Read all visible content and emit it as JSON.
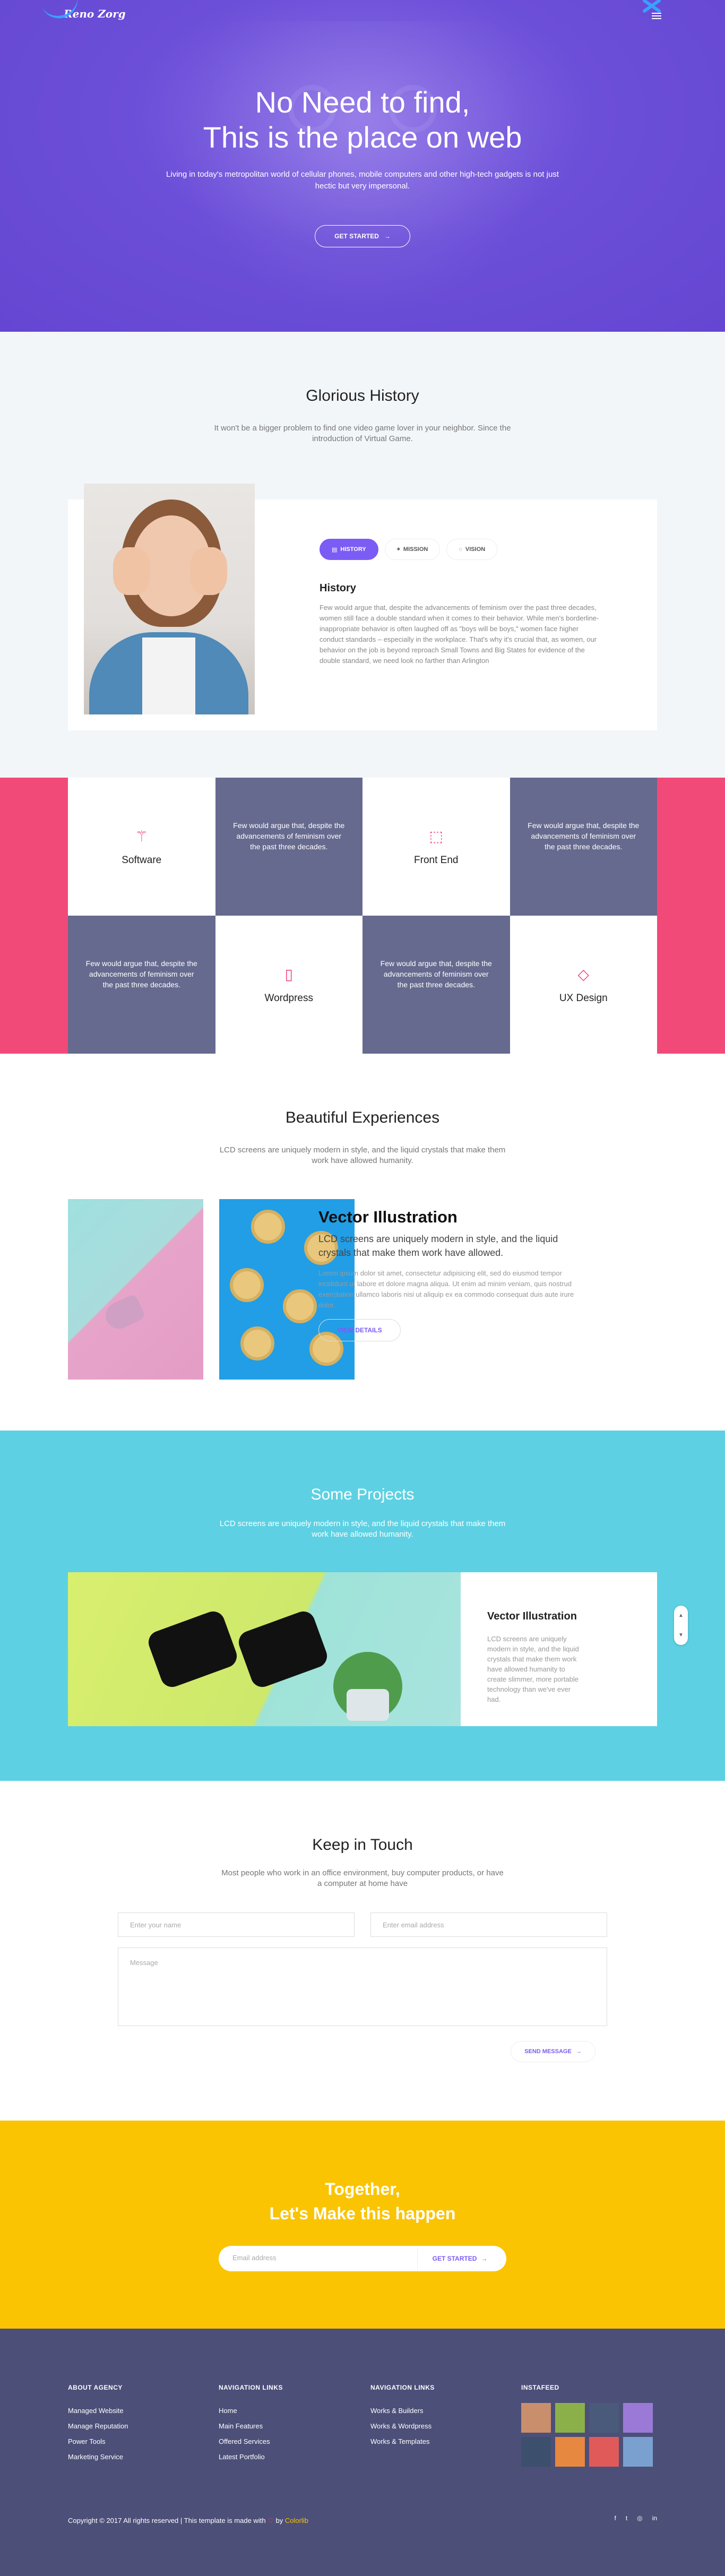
{
  "header": {
    "logo": "Reno Zorg",
    "hero_title_line1": "No Need to find,",
    "hero_title_line2": "This is the place on web",
    "hero_sub": "Living in today's metropolitan world of cellular phones, mobile computers and other high-tech gadgets is not just hectic but very impersonal.",
    "hero_button": "GET STARTED"
  },
  "history": {
    "title": "Glorious History",
    "text": "It won't be a bigger problem to find one video game lover in your neighbor. Since the introduction of Virtual Game.",
    "tabs": [
      {
        "label": "HISTORY",
        "active": true
      },
      {
        "label": "MISSION",
        "active": false
      },
      {
        "label": "VISION",
        "active": false
      }
    ],
    "heading": "History",
    "paragraph": "Few would argue that, despite the advancements of feminism over the past three decades, women still face a double standard when it comes to their behavior. While men's borderline-inappropriate behavior is often laughed off as \"boys will be boys,\" women face higher conduct standards – especially in the workplace. That's why it's crucial that, as women, our behavior on the job is beyond reproach Small Towns and Big States for evidence of the double standard, we need look no farther than Arlington"
  },
  "features": {
    "cells": [
      {
        "type": "icon",
        "label": "Software",
        "icon": "magic-wand-icon"
      },
      {
        "type": "text",
        "text": "Few would argue that, despite the advancements of feminism over the past three decades."
      },
      {
        "type": "icon",
        "label": "Front End",
        "icon": "cursor-icon"
      },
      {
        "type": "text",
        "text": "Few would argue that, despite the advancements of feminism over the past three decades."
      },
      {
        "type": "text",
        "text": "Few would argue that, despite the advancements of feminism over the past three decades."
      },
      {
        "type": "icon",
        "label": "Wordpress",
        "icon": "tablet-icon"
      },
      {
        "type": "text",
        "text": "Few would argue that, despite the advancements of feminism over the past three decades."
      },
      {
        "type": "icon",
        "label": "UX Design",
        "icon": "diamond-icon"
      }
    ]
  },
  "experiences": {
    "title": "Beautiful Experiences",
    "text": "LCD screens are uniquely modern in style, and the liquid crystals that make them work have allowed humanity.",
    "heading": "Vector Illustration",
    "lead": "LCD screens are uniquely modern in style, and the liquid crystals that make them work have allowed.",
    "paragraph": "Lorem ipsum dolor sit amet, consectetur adipisicing elit, sed do eiusmod tempor incididunt ut labore et dolore magna aliqua. Ut enim ad minim veniam, quis nostrud exercitation ullamco laboris nisi ut aliquip ex ea commodo consequat duis aute irure dolor.",
    "button": "VIEW DETAILS"
  },
  "projects": {
    "title": "Some Projects",
    "text": "LCD screens are uniquely modern in style, and the liquid crystals that make them work have allowed humanity.",
    "heading": "Vector Illustration",
    "paragraph": "LCD screens are uniquely modern in style, and the liquid crystals that make them work have allowed humanity to create slimmer, more portable technology than we've ever had."
  },
  "contact": {
    "title": "Keep in Touch",
    "text": "Most people who work in an office environment, buy computer products, or have a computer at home have",
    "name_placeholder": "Enter your name",
    "email_placeholder": "Enter email address",
    "message_placeholder": "Message",
    "send_button": "SEND MESSAGE"
  },
  "cta": {
    "title_line1": "Together,",
    "title_line2": "Let's Make this happen",
    "email_placeholder": "Email address",
    "button": "GET STARTED"
  },
  "footer": {
    "col1": {
      "title": "ABOUT AGENCY",
      "links": [
        "Managed Website",
        "Manage Reputation",
        "Power Tools",
        "Marketing Service"
      ]
    },
    "col2": {
      "title": "NAVIGATION LINKS",
      "links": [
        "Home",
        "Main Features",
        "Offered Services",
        "Latest Portfolio"
      ]
    },
    "col3": {
      "title": "NAVIGATION LINKS",
      "links": [
        "Works & Builders",
        "Works & Wordpress",
        "Works & Templates"
      ]
    },
    "col4": {
      "title": "INSTAFEED"
    },
    "insta_colors": [
      "#c98e6b",
      "#8bb04a",
      "#4a5a7a",
      "#9a7ad6",
      "#3c4f6c",
      "#e6883f",
      "#e05a5a",
      "#7aa0d0"
    ],
    "copyright_pre": "Copyright © 2017 All rights reserved | This template is made with",
    "heart": "♡",
    "copyright_by": "by",
    "copyright_brand": "Colorlib",
    "social": [
      "f",
      "t",
      "◎",
      "in"
    ]
  },
  "colors": {
    "purple": "#7b5cf5",
    "pink": "#f24a78",
    "slate": "#666a8e",
    "cyan": "#5dd1e3",
    "yellow": "#fac403",
    "footer": "#4c4f78"
  }
}
